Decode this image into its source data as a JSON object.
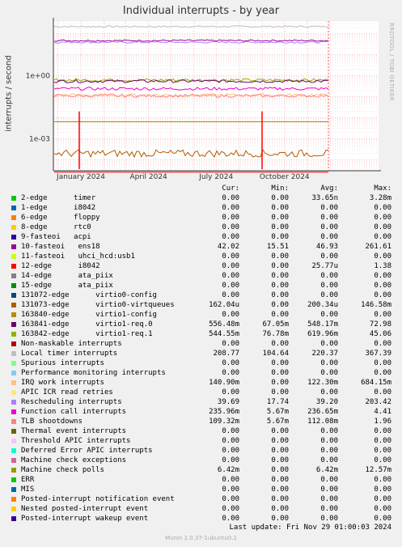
{
  "title": "Individual interrupts - by year",
  "side_label": "RRDTOOL / TOBI OETIKER",
  "footer": {
    "last_update": "Last update: Fri Nov 29 01:00:03 2024",
    "munin": "Munin 2.0.37-1ubuntu0.1"
  },
  "legend": {
    "columns": [
      "Cur:",
      "Min:",
      "Avg:",
      "Max:"
    ],
    "rows": [
      {
        "label": "2-edge      timer",
        "color": "#00cc00",
        "cur": "0.00",
        "min": "0.00",
        "avg": "33.65n",
        "max": "3.28m"
      },
      {
        "label": "1-edge      i8042",
        "color": "#0066b3",
        "cur": "0.00",
        "min": "0.00",
        "avg": "0.00",
        "max": "0.00"
      },
      {
        "label": "6-edge      floppy",
        "color": "#ff8000",
        "cur": "0.00",
        "min": "0.00",
        "avg": "0.00",
        "max": "0.00"
      },
      {
        "label": "8-edge      rtc0",
        "color": "#ffcc00",
        "cur": "0.00",
        "min": "0.00",
        "avg": "0.00",
        "max": "0.00"
      },
      {
        "label": "9-fasteoi   acpi",
        "color": "#330099",
        "cur": "0.00",
        "min": "0.00",
        "avg": "0.00",
        "max": "0.00"
      },
      {
        "label": "10-fasteoi   ens18",
        "color": "#990099",
        "cur": "42.02",
        "min": "15.51",
        "avg": "46.93",
        "max": "261.61"
      },
      {
        "label": "11-fasteoi   uhci_hcd:usb1",
        "color": "#ccff00",
        "cur": "0.00",
        "min": "0.00",
        "avg": "0.00",
        "max": "0.00"
      },
      {
        "label": "12-edge      i8042",
        "color": "#ff0000",
        "cur": "0.00",
        "min": "0.00",
        "avg": "25.77u",
        "max": "1.38"
      },
      {
        "label": "14-edge      ata_piix",
        "color": "#808080",
        "cur": "0.00",
        "min": "0.00",
        "avg": "0.00",
        "max": "0.00"
      },
      {
        "label": "15-edge      ata_piix",
        "color": "#008f00",
        "cur": "0.00",
        "min": "0.00",
        "avg": "0.00",
        "max": "0.00"
      },
      {
        "label": "131072-edge      virtio0-config",
        "color": "#00487d",
        "cur": "0.00",
        "min": "0.00",
        "avg": "0.00",
        "max": "0.00"
      },
      {
        "label": "131073-edge      virtio0-virtqueues",
        "color": "#b35a00",
        "cur": "162.04u",
        "min": "0.00",
        "avg": "200.34u",
        "max": "146.58m"
      },
      {
        "label": "163840-edge      virtio1-config",
        "color": "#b38f00",
        "cur": "0.00",
        "min": "0.00",
        "avg": "0.00",
        "max": "0.00"
      },
      {
        "label": "163841-edge      virtio1-req.0",
        "color": "#6b006b",
        "cur": "556.48m",
        "min": "67.05m",
        "avg": "548.17m",
        "max": "72.98"
      },
      {
        "label": "163842-edge      virtio1-req.1",
        "color": "#8fb300",
        "cur": "544.55m",
        "min": "76.78m",
        "avg": "619.96m",
        "max": "45.06"
      },
      {
        "label": "Non-maskable interrupts",
        "color": "#b30000",
        "cur": "0.00",
        "min": "0.00",
        "avg": "0.00",
        "max": "0.00"
      },
      {
        "label": "Local timer interrupts",
        "color": "#bebebe",
        "cur": "208.77",
        "min": "104.64",
        "avg": "220.37",
        "max": "367.39"
      },
      {
        "label": "Spurious interrupts",
        "color": "#80ff80",
        "cur": "0.00",
        "min": "0.00",
        "avg": "0.00",
        "max": "0.00"
      },
      {
        "label": "Performance monitoring interrupts",
        "color": "#80c9ff",
        "cur": "0.00",
        "min": "0.00",
        "avg": "0.00",
        "max": "0.00"
      },
      {
        "label": "IRQ work interrupts",
        "color": "#ffc080",
        "cur": "140.90m",
        "min": "0.00",
        "avg": "122.30m",
        "max": "684.15m"
      },
      {
        "label": "APIC ICR read retries",
        "color": "#ffe680",
        "cur": "0.00",
        "min": "0.00",
        "avg": "0.00",
        "max": "0.00"
      },
      {
        "label": "Rescheduling interrupts",
        "color": "#aa80ff",
        "cur": "39.69",
        "min": "17.74",
        "avg": "39.20",
        "max": "203.42"
      },
      {
        "label": "Function call interrupts",
        "color": "#ee00cc",
        "cur": "235.96m",
        "min": "5.67m",
        "avg": "236.65m",
        "max": "4.41"
      },
      {
        "label": "TLB shootdowns",
        "color": "#ff8080",
        "cur": "109.32m",
        "min": "5.67m",
        "avg": "112.08m",
        "max": "1.96"
      },
      {
        "label": "Thermal event interrupts",
        "color": "#666600",
        "cur": "0.00",
        "min": "0.00",
        "avg": "0.00",
        "max": "0.00"
      },
      {
        "label": "Threshold APIC interrupts",
        "color": "#ffbfff",
        "cur": "0.00",
        "min": "0.00",
        "avg": "0.00",
        "max": "0.00"
      },
      {
        "label": "Deferred Error APIC interrupts",
        "color": "#00ffcc",
        "cur": "0.00",
        "min": "0.00",
        "avg": "0.00",
        "max": "0.00"
      },
      {
        "label": "Machine check exceptions",
        "color": "#cc6699",
        "cur": "0.00",
        "min": "0.00",
        "avg": "0.00",
        "max": "0.00"
      },
      {
        "label": "Machine check polls",
        "color": "#999900",
        "cur": "6.42m",
        "min": "0.00",
        "avg": "6.42m",
        "max": "12.57m"
      },
      {
        "label": "ERR",
        "color": "#00cc00",
        "cur": "0.00",
        "min": "0.00",
        "avg": "0.00",
        "max": "0.00"
      },
      {
        "label": "MIS",
        "color": "#0066b3",
        "cur": "0.00",
        "min": "0.00",
        "avg": "0.00",
        "max": "0.00"
      },
      {
        "label": "Posted-interrupt notification event",
        "color": "#ff8000",
        "cur": "0.00",
        "min": "0.00",
        "avg": "0.00",
        "max": "0.00"
      },
      {
        "label": "Nested posted-interrupt event",
        "color": "#ffcc00",
        "cur": "0.00",
        "min": "0.00",
        "avg": "0.00",
        "max": "0.00"
      },
      {
        "label": "Posted-interrupt wakeup event",
        "color": "#330099",
        "cur": "0.00",
        "min": "0.00",
        "avg": "0.00",
        "max": "0.00"
      }
    ]
  },
  "chart_data": {
    "type": "line",
    "title": "Individual interrupts - by year",
    "ylabel": "interrupts / second",
    "y_scale": "log",
    "ylim": [
      3e-05,
      400
    ],
    "y_ticks": [
      {
        "value": 1,
        "label": "1e+00"
      },
      {
        "value": 0.001,
        "label": "1e-03"
      }
    ],
    "x_ticks": [
      "January 2024",
      "April 2024",
      "July 2024",
      "October 2024"
    ],
    "xlim": [
      "2023-11-25",
      "2024-11-29"
    ],
    "x_tick_dates": [
      "2024-01-01",
      "2024-04-01",
      "2024-07-01",
      "2024-10-01"
    ],
    "grid": true,
    "series": [
      {
        "name": "Local timer interrupts",
        "color": "#bebebe",
        "level": 220
      },
      {
        "name": "10-fasteoi   ens18",
        "color": "#990099",
        "level": 47
      },
      {
        "name": "Rescheduling interrupts",
        "color": "#aa80ff",
        "level": 39
      },
      {
        "name": "163842-edge      virtio1-req.1",
        "color": "#8fb300",
        "level": 0.62
      },
      {
        "name": "163841-edge      virtio1-req.0",
        "color": "#6b006b",
        "level": 0.55
      },
      {
        "name": "Function call interrupts",
        "color": "#ee00cc",
        "level": 0.24
      },
      {
        "name": "IRQ work interrupts",
        "color": "#ffc080",
        "level": 0.12
      },
      {
        "name": "TLB shootdowns",
        "color": "#ff8080",
        "level": 0.11
      },
      {
        "name": "Machine check polls",
        "color": "#999900",
        "level": 0.0064
      },
      {
        "name": "131073-edge      virtio0-virtqueues",
        "color": "#b35a00",
        "level": 0.0002
      },
      {
        "name": "12-edge      i8042",
        "color": "#ff0000",
        "level": 2.58e-05
      }
    ]
  }
}
